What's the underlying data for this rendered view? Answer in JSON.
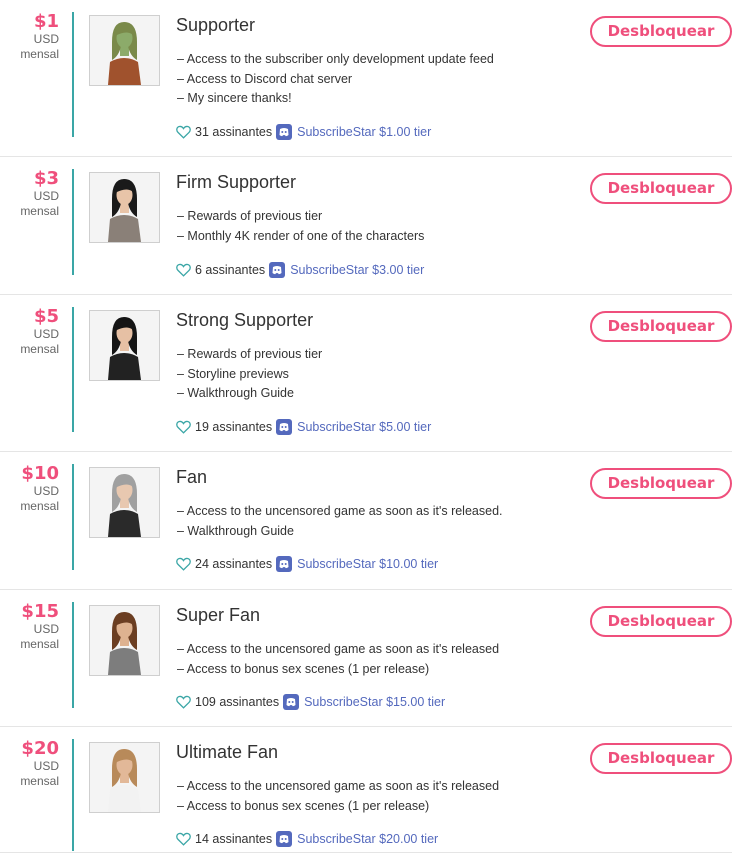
{
  "unlock_label": "Desbloquear",
  "colors": {
    "accent_pink": "#ef4f7c",
    "divider_teal": "#3aa6a6",
    "discord_blue": "#5469bd"
  },
  "tiers": [
    {
      "price": "$1",
      "currency": "USD",
      "period": "mensal",
      "title": "Supporter",
      "benefits": [
        "– Access to the subscriber only development update feed",
        "– Access to Discord chat server",
        "– My sincere thanks!"
      ],
      "subscribers": "31 assinantes",
      "discord": "SubscribeStar $1.00 tier",
      "avatar": {
        "skin": "#8cab6a",
        "hair": "#7a8a4a",
        "outfit": "#a0522d"
      }
    },
    {
      "price": "$3",
      "currency": "USD",
      "period": "mensal",
      "title": "Firm Supporter",
      "benefits": [
        "– Rewards of previous tier",
        "– Monthly 4K render of one of the characters"
      ],
      "subscribers": "6 assinantes",
      "discord": "SubscribeStar $3.00 tier",
      "avatar": {
        "skin": "#e8c4a8",
        "hair": "#1a1a1a",
        "outfit": "#8a8078"
      }
    },
    {
      "price": "$5",
      "currency": "USD",
      "period": "mensal",
      "title": "Strong Supporter",
      "benefits": [
        "– Rewards of previous tier",
        "– Storyline previews",
        "– Walkthrough Guide"
      ],
      "subscribers": "19 assinantes",
      "discord": "SubscribeStar $5.00 tier",
      "avatar": {
        "skin": "#e6c0a4",
        "hair": "#151515",
        "outfit": "#222222"
      }
    },
    {
      "price": "$10",
      "currency": "USD",
      "period": "mensal",
      "title": "Fan",
      "benefits": [
        "– Access to the uncensored game as soon as it's released.",
        "– Walkthrough Guide"
      ],
      "subscribers": "24 assinantes",
      "discord": "SubscribeStar $10.00 tier",
      "avatar": {
        "skin": "#e8c8b0",
        "hair": "#a0a0a0",
        "outfit": "#2a2a2a"
      }
    },
    {
      "price": "$15",
      "currency": "USD",
      "period": "mensal",
      "title": "Super Fan",
      "benefits": [
        "– Access to the uncensored game as soon as it's released",
        "– Access to bonus sex scenes (1 per release)"
      ],
      "subscribers": "109 assinantes",
      "discord": "SubscribeStar $15.00 tier",
      "avatar": {
        "skin": "#deb290",
        "hair": "#6b3e22",
        "outfit": "#7d7d7d"
      }
    },
    {
      "price": "$20",
      "currency": "USD",
      "period": "mensal",
      "title": "Ultimate Fan",
      "benefits": [
        "– Access to the uncensored game as soon as it's released",
        "– Access to bonus sex scenes (1 per release)"
      ],
      "subscribers": "14 assinantes",
      "discord": "SubscribeStar $20.00 tier",
      "avatar": {
        "skin": "#e2b898",
        "hair": "#b88a5a",
        "outfit": "#f2f2f2"
      }
    }
  ]
}
